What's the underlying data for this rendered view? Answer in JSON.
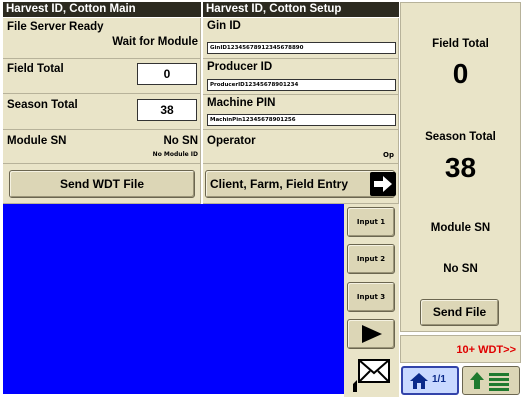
{
  "main": {
    "header": "Harvest ID, Cotton Main",
    "file_server_label": "File Server Ready",
    "file_server_status": "Wait for Module",
    "field_total_label": "Field Total",
    "field_total_value": "0",
    "season_total_label": "Season Total",
    "season_total_value": "38",
    "module_sn_label": "Module SN",
    "module_sn_value": "No SN",
    "module_id_value": "No Module ID",
    "send_wdt_label": "Send WDT File"
  },
  "setup": {
    "header": "Harvest ID, Cotton Setup",
    "gin_id_label": "Gin ID",
    "gin_id_value": "GinID12345678912345678890",
    "producer_id_label": "Producer ID",
    "producer_id_value": "ProducerID12345678901234",
    "machine_pin_label": "Machine PIN",
    "machine_pin_value": "MachinPin12345678901256",
    "operator_label": "Operator",
    "operator_value": "Op",
    "client_farm_field_label": "Client, Farm, Field Entry"
  },
  "side_buttons": {
    "input1": "Input 1",
    "input2": "Input 2",
    "input3": "Input 3"
  },
  "right_panel": {
    "field_total_label": "Field Total",
    "field_total_value": "0",
    "season_total_label": "Season Total",
    "season_total_value": "38",
    "module_sn_label": "Module SN",
    "module_sn_value": "No SN",
    "send_file_label": "Send File",
    "wdt_count_label": "10+ WDT>>",
    "page_indicator": "1/1"
  },
  "colors": {
    "panel": "#e9e4c8",
    "header": "#2c2a20",
    "map_blue": "#0000ff",
    "alert_red": "#e00000",
    "home_button": "#c9d9ff"
  },
  "icons": {
    "arrow_right": "arrow-right-icon",
    "play": "play-icon",
    "envelope": "envelope-icon",
    "home": "home-icon",
    "menu": "menu-up-icon"
  }
}
